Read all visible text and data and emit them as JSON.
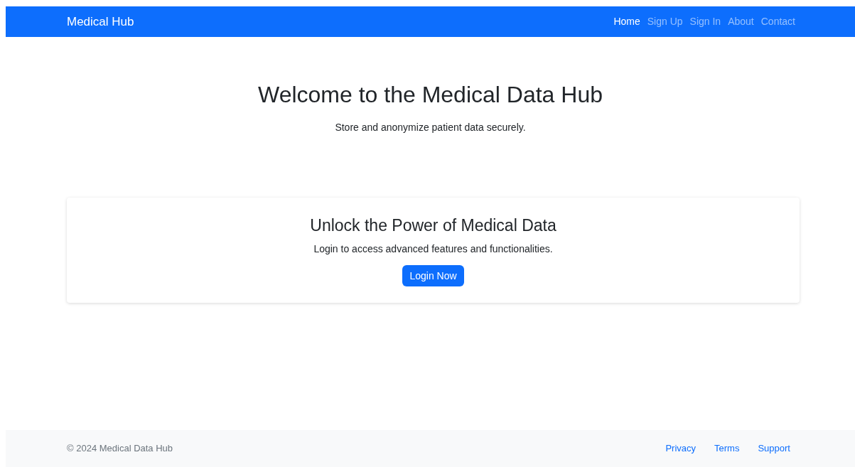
{
  "navbar": {
    "brand": "Medical Hub",
    "links": [
      {
        "label": "Home",
        "selected": true
      },
      {
        "label": "Sign Up",
        "selected": false
      },
      {
        "label": "Sign In",
        "selected": false
      },
      {
        "label": "About",
        "selected": false
      },
      {
        "label": "Contact",
        "selected": false
      }
    ]
  },
  "hero": {
    "title": "Welcome to the Medical Data Hub",
    "subtitle": "Store and anonymize patient data securely."
  },
  "card": {
    "title": "Unlock the Power of Medical Data",
    "text": "Login to access advanced features and functionalities.",
    "button": "Login Now"
  },
  "footer": {
    "copyright": "© 2024 Medical Data Hub",
    "links": [
      "Privacy",
      "Terms",
      "Support"
    ]
  }
}
